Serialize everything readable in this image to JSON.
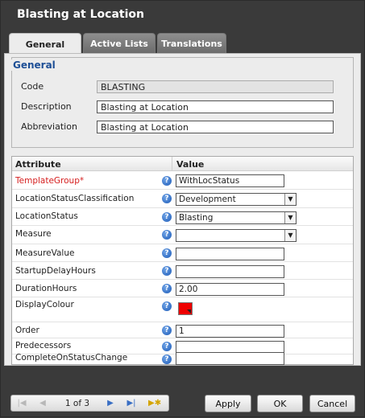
{
  "window": {
    "title": "Blasting at Location"
  },
  "tabs": [
    {
      "label": "General"
    },
    {
      "label": "Active Lists"
    },
    {
      "label": "Translations"
    }
  ],
  "general": {
    "legend": "General",
    "code_label": "Code",
    "code_value": "BLASTING",
    "description_label": "Description",
    "description_value": "Blasting at Location",
    "abbreviation_label": "Abbreviation",
    "abbreviation_value": "Blasting at Location"
  },
  "grid": {
    "col_attribute": "Attribute",
    "col_value": "Value",
    "rows": [
      {
        "label": "TemplateGroup*",
        "value": "WithLocStatus",
        "type": "text",
        "required": true
      },
      {
        "label": "LocationStatusClassification",
        "value": "Development",
        "type": "select"
      },
      {
        "label": "LocationStatus",
        "value": "Blasting",
        "type": "select"
      },
      {
        "label": "Measure",
        "value": "",
        "type": "select"
      },
      {
        "label": "MeasureValue",
        "value": "",
        "type": "text"
      },
      {
        "label": "StartupDelayHours",
        "value": "",
        "type": "text"
      },
      {
        "label": "DurationHours",
        "value": "2.00",
        "type": "text"
      },
      {
        "label": "DisplayColour",
        "value": "#ee0000",
        "type": "color"
      },
      {
        "label": "Order",
        "value": "1",
        "type": "text"
      },
      {
        "label": "Predecessors",
        "value": "",
        "type": "text"
      },
      {
        "label": "CompleteOnStatusChange",
        "value": "",
        "type": "text"
      }
    ]
  },
  "pager": {
    "count": "1 of 3"
  },
  "buttons": {
    "apply": "Apply",
    "ok": "OK",
    "cancel": "Cancel"
  },
  "colors": {
    "accent": "#1e4f96",
    "required": "#d62020",
    "help_icon": "#1c5bb8",
    "header_bg": "#3a3a3a"
  }
}
